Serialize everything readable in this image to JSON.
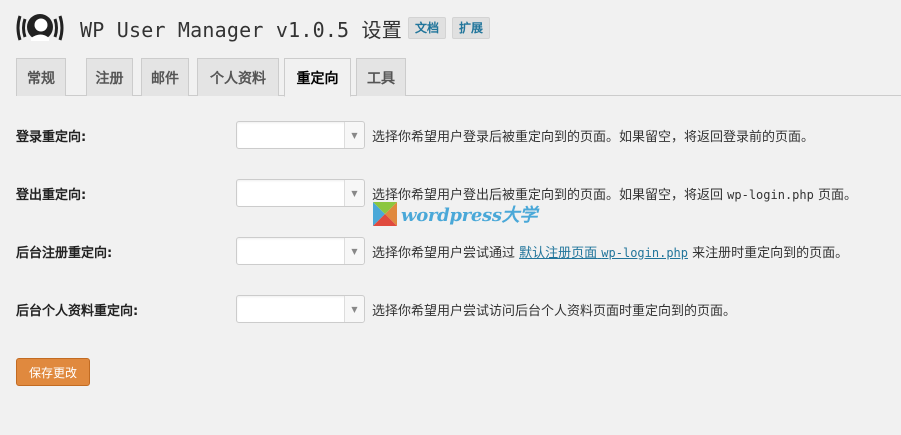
{
  "header": {
    "title": "WP User Manager v1.0.5 设置",
    "docs_label": "文档",
    "extensions_label": "扩展"
  },
  "tabs": [
    {
      "label": "常规",
      "active": false
    },
    {
      "label": "注册",
      "active": false
    },
    {
      "label": "邮件",
      "active": false
    },
    {
      "label": "个人资料",
      "active": false
    },
    {
      "label": "重定向",
      "active": true
    },
    {
      "label": "工具",
      "active": false
    }
  ],
  "fields": {
    "login": {
      "label": "登录重定向:",
      "value": "",
      "description": "选择你希望用户登录后被重定向到的页面。如果留空，将返回登录前的页面。"
    },
    "logout": {
      "label": "登出重定向:",
      "value": "",
      "desc_before": "选择你希望用户登出后被重定向到的页面。如果留空，将返回 ",
      "desc_code": "wp-login.php",
      "desc_after": " 页面。"
    },
    "register": {
      "label": "后台注册重定向:",
      "value": "",
      "desc_before": "选择你希望用户尝试通过 ",
      "desc_link_text": "默认注册页面",
      "desc_link_code": "wp-login.php",
      "desc_after": " 来注册时重定向到的页面。"
    },
    "profile": {
      "label": "后台个人资料重定向:",
      "value": "",
      "description": "选择你希望用户尝试访问后台个人资料页面时重定向到的页面。"
    }
  },
  "save_label": "保存更改",
  "watermark": {
    "text": "wordpress大学",
    "icon": "wpdaxue-logo-icon"
  },
  "colors": {
    "accent": "#e0893e",
    "link": "#21759b"
  }
}
